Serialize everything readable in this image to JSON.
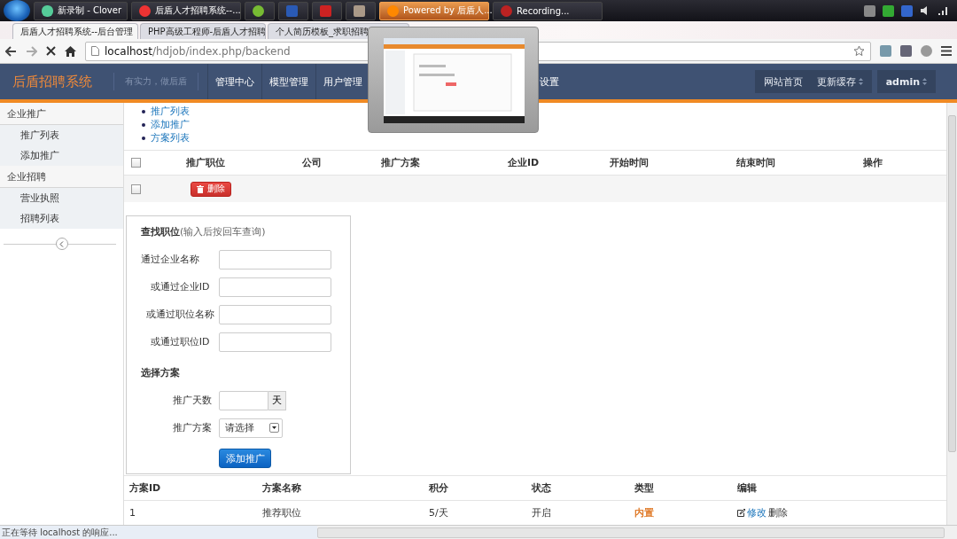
{
  "taskbar": {
    "items": [
      {
        "kind": "window",
        "label": "新录制 - Clover",
        "selected": false
      },
      {
        "kind": "window",
        "label": "后盾人才招聘系统--...",
        "selected": false
      },
      {
        "kind": "pinned"
      },
      {
        "kind": "pinned"
      },
      {
        "kind": "pinned"
      },
      {
        "kind": "pinned"
      },
      {
        "kind": "window",
        "label": "Powered by 后盾人...",
        "selected": true
      },
      {
        "kind": "window",
        "label": "Recording...",
        "selected": false
      }
    ]
  },
  "browser": {
    "tabs": [
      {
        "label": "后盾人才招聘系统--后台管理",
        "selected": true
      },
      {
        "label": "PHP高级工程师-后盾人才招聘",
        "selected": false
      },
      {
        "label": "个人简历模板_求职招聘",
        "selected": false
      }
    ],
    "url_host": "localhost",
    "url_path": "/hdjob/index.php/backend"
  },
  "header": {
    "logo": "后盾招聘系统",
    "tagline": "有实力，做后盾",
    "nav": [
      "管理中心",
      "模型管理",
      "用户管理",
      "设置"
    ],
    "links": [
      "网站首页",
      "更新缓存"
    ],
    "user": "admin"
  },
  "sidebar": {
    "groups": [
      {
        "title": "企业推广",
        "items": [
          "推广列表",
          "添加推广"
        ]
      },
      {
        "title": "企业招聘",
        "items": [
          "营业执照",
          "招聘列表"
        ]
      }
    ]
  },
  "sublinks": [
    "推广列表",
    "添加推广",
    "方案列表"
  ],
  "table": {
    "select_all": {
      "checked": false
    },
    "columns": [
      "推广职位",
      "公司",
      "推广方案",
      "企业ID",
      "开始时间",
      "结束时间",
      "操作"
    ],
    "bulk": {
      "checked": false,
      "action": "删除"
    }
  },
  "search_form": {
    "title": "查找职位",
    "hint": "(输入后按回车查询)",
    "fields": [
      "通过企业名称",
      "或通过企业ID",
      "或通过职位名称",
      "或通过职位ID"
    ],
    "plan_title": "选择方案",
    "days_label": "推广天数",
    "days_unit": "天",
    "plan_label": "推广方案",
    "plan_value": "请选择",
    "submit": "添加推广"
  },
  "plans": {
    "columns": [
      "方案ID",
      "方案名称",
      "积分",
      "状态",
      "类型",
      "编辑"
    ],
    "rows": [
      {
        "id": "1",
        "name": "推荐职位",
        "points": "5/天",
        "status": "开启",
        "type": "内置",
        "color": "#e07b2a",
        "edit": "修改",
        "delete": "删除"
      }
    ]
  },
  "status_bar": "正在等待 localhost 的响应..."
}
